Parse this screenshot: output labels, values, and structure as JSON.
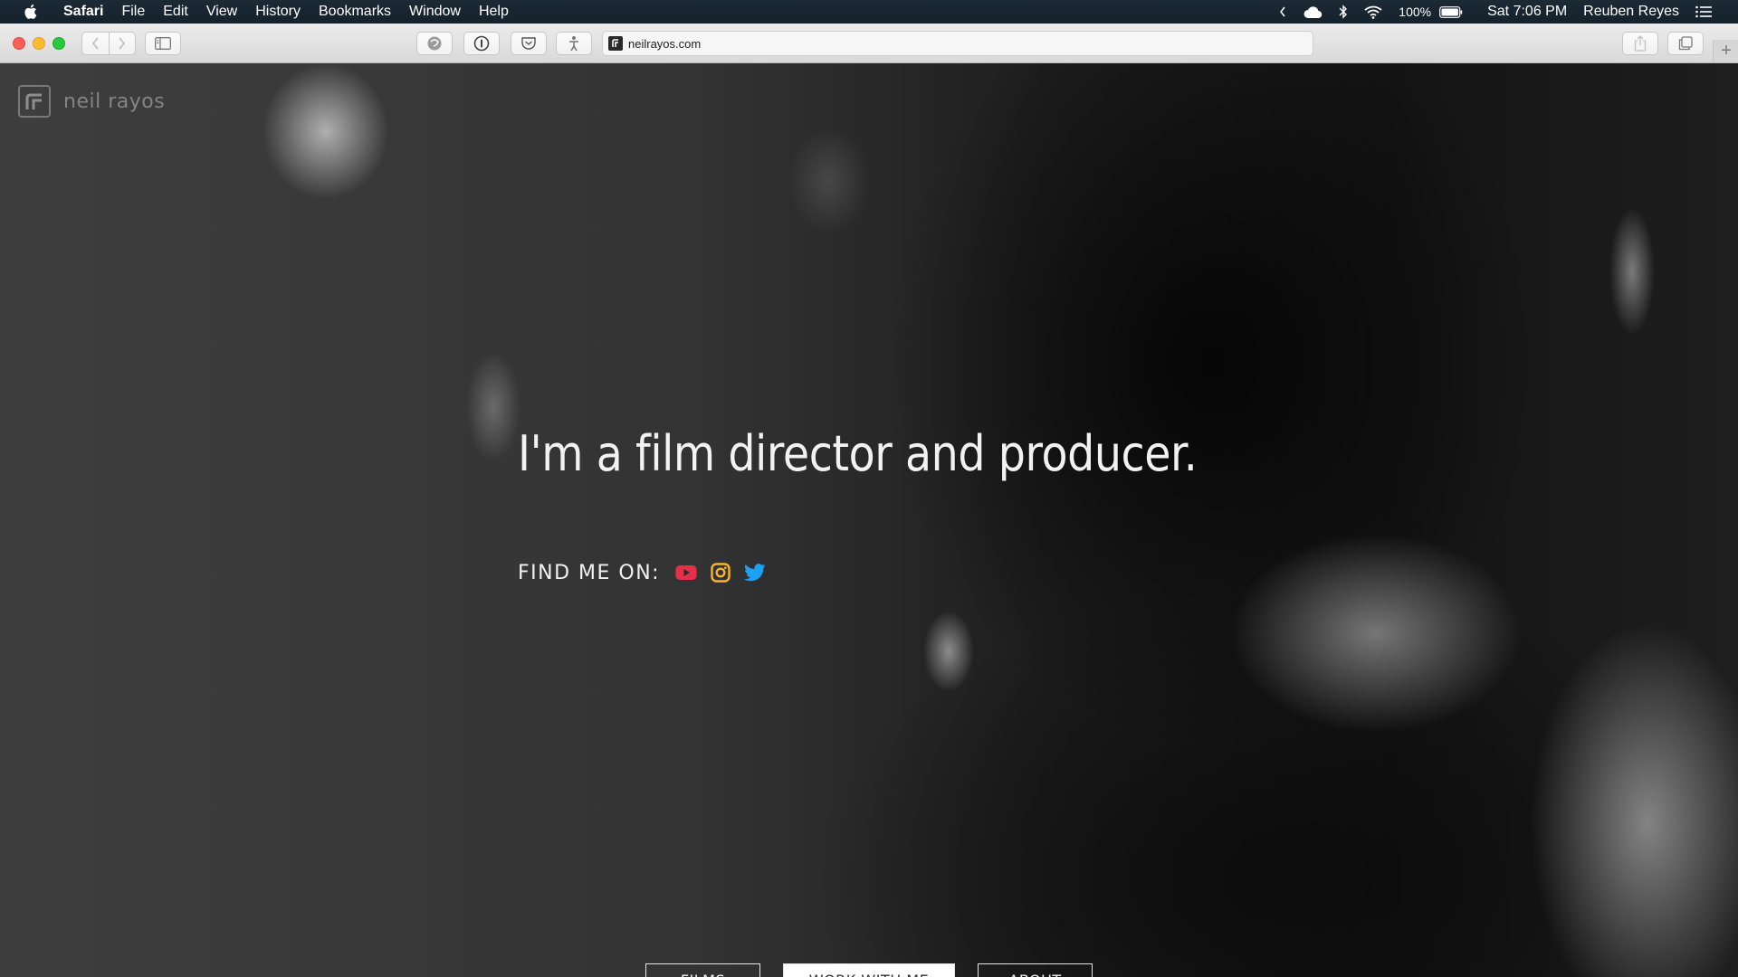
{
  "menubar": {
    "app_name": "Safari",
    "menus": [
      "File",
      "Edit",
      "View",
      "History",
      "Bookmarks",
      "Window",
      "Help"
    ],
    "battery": "100%",
    "clock": "Sat 7:06 PM",
    "user": "Reuben Reyes"
  },
  "browser": {
    "url": "neilrayos.com",
    "new_tab": "+"
  },
  "site": {
    "logo_text": "neil rayos",
    "headline": "I'm a film director and producer.",
    "find_me_label": "FIND ME ON:",
    "social_icons": [
      "youtube-icon",
      "instagram-icon",
      "twitter-icon"
    ],
    "nav": {
      "films": "FILMS",
      "work_with_me": "WORK WITH ME",
      "about": "ABOUT"
    },
    "colors": {
      "youtube": "#e62f48",
      "instagram": "#f5b52e",
      "twitter": "#1da1f2"
    }
  }
}
